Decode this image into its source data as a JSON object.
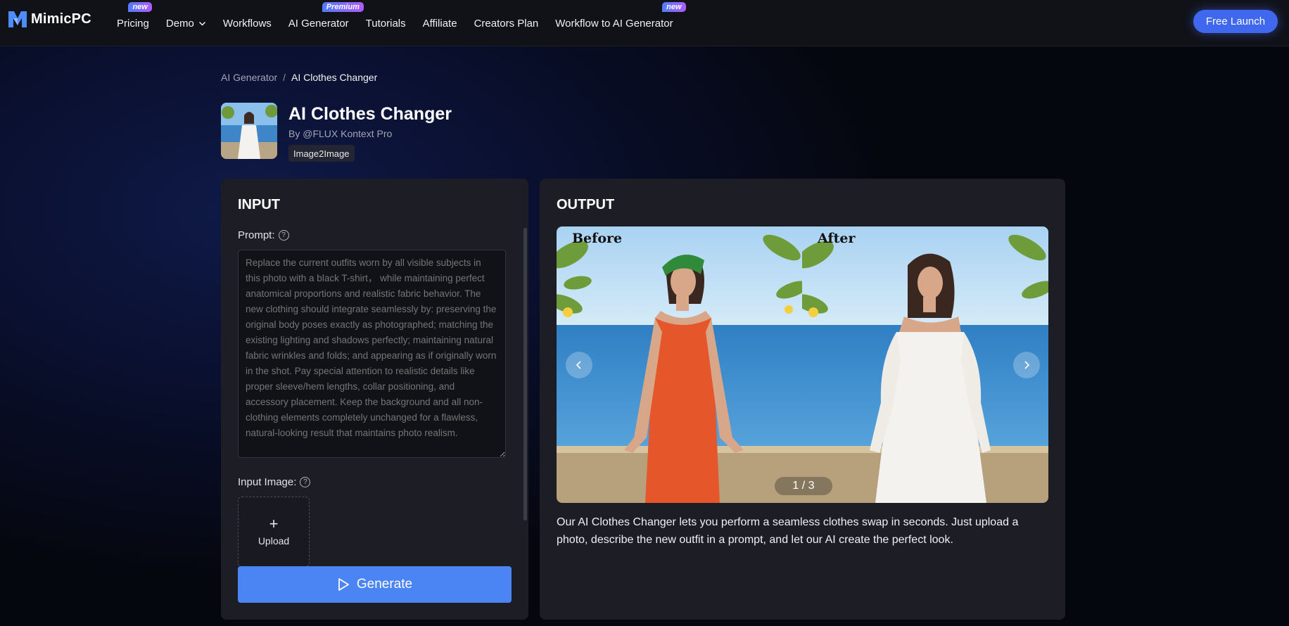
{
  "brand": {
    "name": "MimicPC",
    "accent": "#3f68ee"
  },
  "nav": {
    "items": [
      {
        "label": "Pricing",
        "badge": "new"
      },
      {
        "label": "Demo",
        "dropdown": true
      },
      {
        "label": "Workflows"
      },
      {
        "label": "AI Generator",
        "badge": "Premium"
      },
      {
        "label": "Tutorials"
      },
      {
        "label": "Affiliate"
      },
      {
        "label": "Creators Plan"
      },
      {
        "label": "Workflow to AI Generator",
        "badge": "new"
      }
    ],
    "cta": "Free Launch"
  },
  "breadcrumb": {
    "parent": "AI Generator",
    "separator": "/",
    "current": "AI Clothes Changer"
  },
  "app": {
    "title": "AI Clothes Changer",
    "author": "By @FLUX Kontext Pro",
    "tag": "Image2Image"
  },
  "input": {
    "title": "INPUT",
    "prompt_label": "Prompt:",
    "prompt_placeholder": "Replace the current outfits worn by all visible subjects in this photo with a black T-shirt， while maintaining perfect anatomical proportions and realistic fabric behavior. The new clothing should integrate seamlessly by: preserving the original body poses exactly as photographed; matching the existing lighting and shadows perfectly; maintaining natural fabric wrinkles and folds; and appearing as if originally worn in the shot. Pay special attention to realistic details like proper sleeve/hem lengths, collar positioning, and accessory placement. Keep the background and all non-clothing elements completely unchanged for a flawless, natural-looking result that maintains photo realism.",
    "image_label": "Input Image:",
    "upload_label": "Upload",
    "generate_label": "Generate"
  },
  "output": {
    "title": "OUTPUT",
    "before_label": "Before",
    "after_label": "After",
    "counter": "1 / 3",
    "description": "Our AI Clothes Changer lets you perform a seamless clothes swap in seconds. Just upload a photo, describe the new outfit in a prompt, and let our AI create the perfect look."
  }
}
